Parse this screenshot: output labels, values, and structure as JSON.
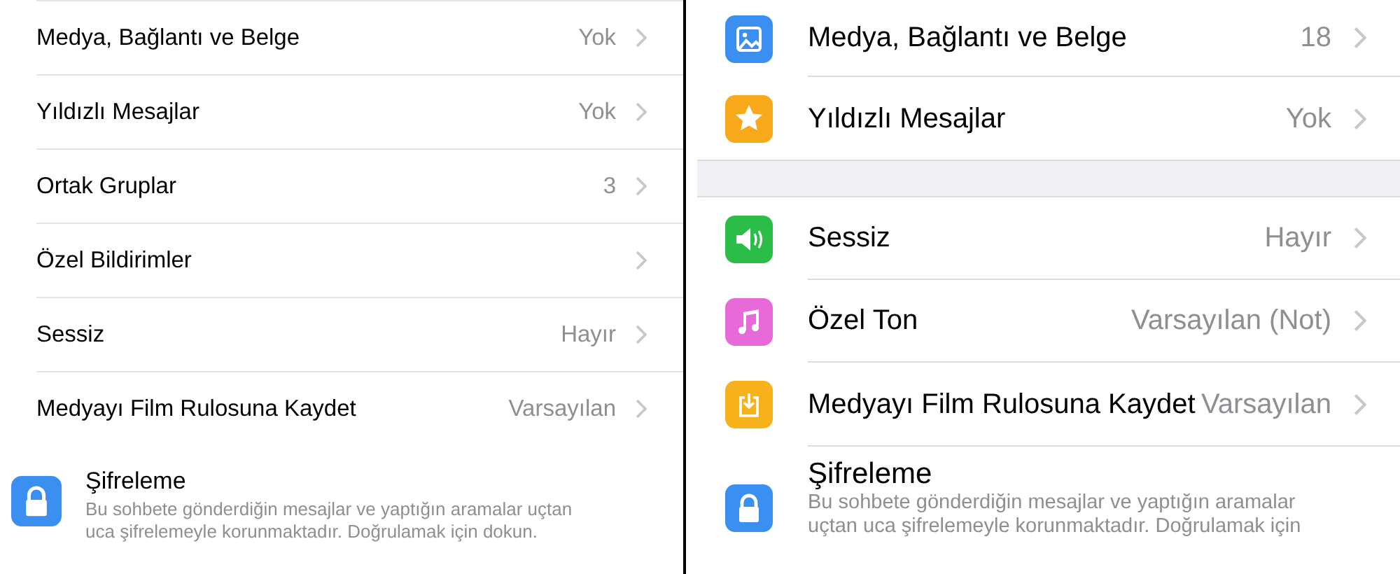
{
  "left_panel": {
    "rows": [
      {
        "label": "Medya, Bağlantı ve Belge",
        "value": "Yok"
      },
      {
        "label": "Yıldızlı Mesajlar",
        "value": "Yok"
      },
      {
        "label": "Ortak Gruplar",
        "value": "3"
      },
      {
        "label": "Özel Bildirimler"
      },
      {
        "label": "Sessiz",
        "value": "Hayır"
      },
      {
        "label": "Medyayı Film Rulosuna Kaydet",
        "value": "Varsayılan"
      }
    ],
    "encryption": {
      "title": "Şifreleme",
      "description_lines": [
        "Bu sohbete gönderdiğin mesajlar ve yaptığın aramalar uçtan",
        "uca şifrelemeyle korunmaktadır. Doğrulamak için dokun."
      ]
    }
  },
  "right_panel": {
    "sections": [
      {
        "rows": [
          {
            "kind": "media",
            "color": "#3b8ff0",
            "label": "Medya, Bağlantı ve Belge",
            "value": "18"
          },
          {
            "kind": "star",
            "color": "#f7a91b",
            "label": "Yıldızlı Mesajlar",
            "value": "Yok"
          }
        ]
      },
      {
        "rows": [
          {
            "kind": "speaker",
            "color": "#2cbd48",
            "label": "Sessiz",
            "value": "Hayır"
          },
          {
            "kind": "music",
            "color": "#e86ad8",
            "label": "Özel Ton",
            "value": "Varsayılan (Not)"
          },
          {
            "kind": "download",
            "color": "#f7b21b",
            "label": "Medyayı Film Rulosuna Kaydet",
            "value": "Varsayılan"
          }
        ]
      }
    ],
    "encryption": {
      "title": "Şifreleme",
      "description_lines": [
        "Bu sohbete gönderdiğin mesajlar ve yaptığın aramalar",
        "uçtan uca şifrelemeyle korunmaktadır. Doğrulamak için"
      ]
    }
  }
}
